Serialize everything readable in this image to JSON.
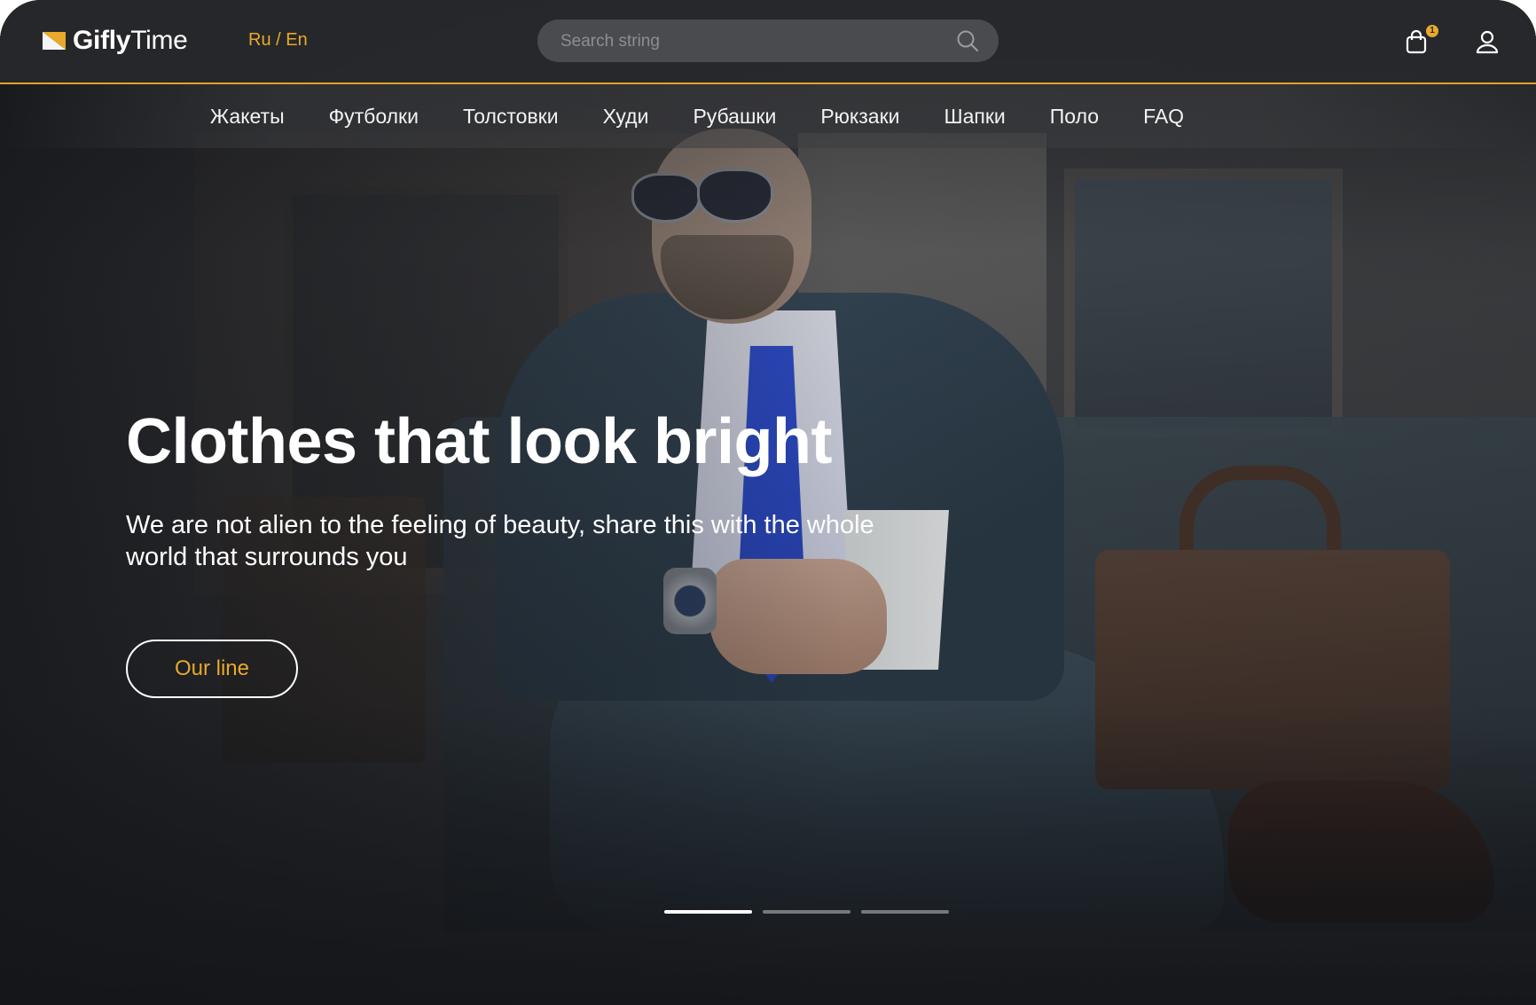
{
  "header": {
    "logo": {
      "part1": "Gifly",
      "part2": "Time"
    },
    "language": "Ru / En",
    "search": {
      "placeholder": "Search string",
      "value": ""
    },
    "cart": {
      "count": "1"
    }
  },
  "nav": {
    "items": [
      "Жакеты",
      "Футболки",
      "Толстовки",
      "Худи",
      "Рубашки",
      "Рюкзаки",
      "Шапки",
      "Поло",
      "FAQ"
    ]
  },
  "hero": {
    "title": "Clothes that look bright",
    "subtitle_line1": "We are not alien to the feeling of beauty, share this with the whole",
    "subtitle_line2": "world that surrounds you",
    "button_label": "Our line"
  },
  "slider": {
    "total_slides": 3,
    "active_index": 0
  },
  "icons": {
    "logo": "logo-mark-icon",
    "search": "search-icon",
    "cart": "shopping-bag-icon",
    "user": "user-icon"
  },
  "colors": {
    "accent": "#e9a92a",
    "text": "#ffffff",
    "header_bg": "#28292c"
  }
}
